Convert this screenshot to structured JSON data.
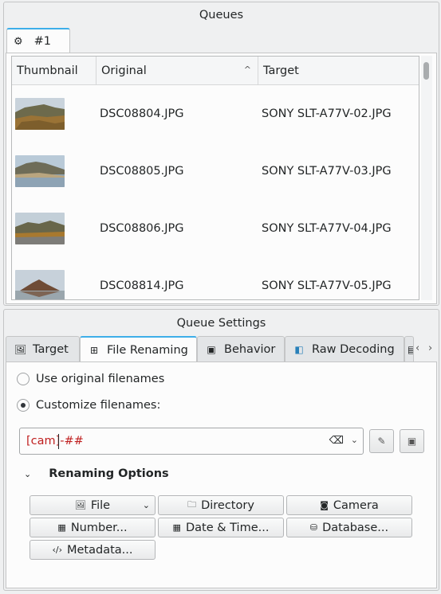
{
  "queues": {
    "title": "Queues",
    "tab_label": "#1",
    "columns": [
      "Thumbnail",
      "Original",
      "Target"
    ],
    "rows": [
      {
        "original": "DSC08804.JPG",
        "target": "SONY SLT-A77V-02.JPG"
      },
      {
        "original": "DSC08805.JPG",
        "target": "SONY SLT-A77V-03.JPG"
      },
      {
        "original": "DSC08806.JPG",
        "target": "SONY SLT-A77V-04.JPG"
      },
      {
        "original": "DSC08814.JPG",
        "target": "SONY SLT-A77V-05.JPG"
      }
    ]
  },
  "settings": {
    "title": "Queue Settings",
    "tabs": [
      {
        "label": "Target",
        "icon": "image-icon"
      },
      {
        "label": "File Renaming",
        "icon": "rename-icon"
      },
      {
        "label": "Behavior",
        "icon": "behavior-icon"
      },
      {
        "label": "Raw Decoding",
        "icon": "raw-icon"
      }
    ],
    "radio_original": "Use original filenames",
    "radio_custom": "Customize filenames:",
    "pattern_value": "[cam]-##",
    "renaming_options": "Renaming Options",
    "buttons": {
      "file": "File",
      "directory": "Directory",
      "camera": "Camera",
      "number": "Number...",
      "datetime": "Date & Time...",
      "database": "Database...",
      "metadata": "Metadata..."
    }
  },
  "colors": {
    "accent": "#3daee9",
    "pattern_text": "#c02020"
  }
}
